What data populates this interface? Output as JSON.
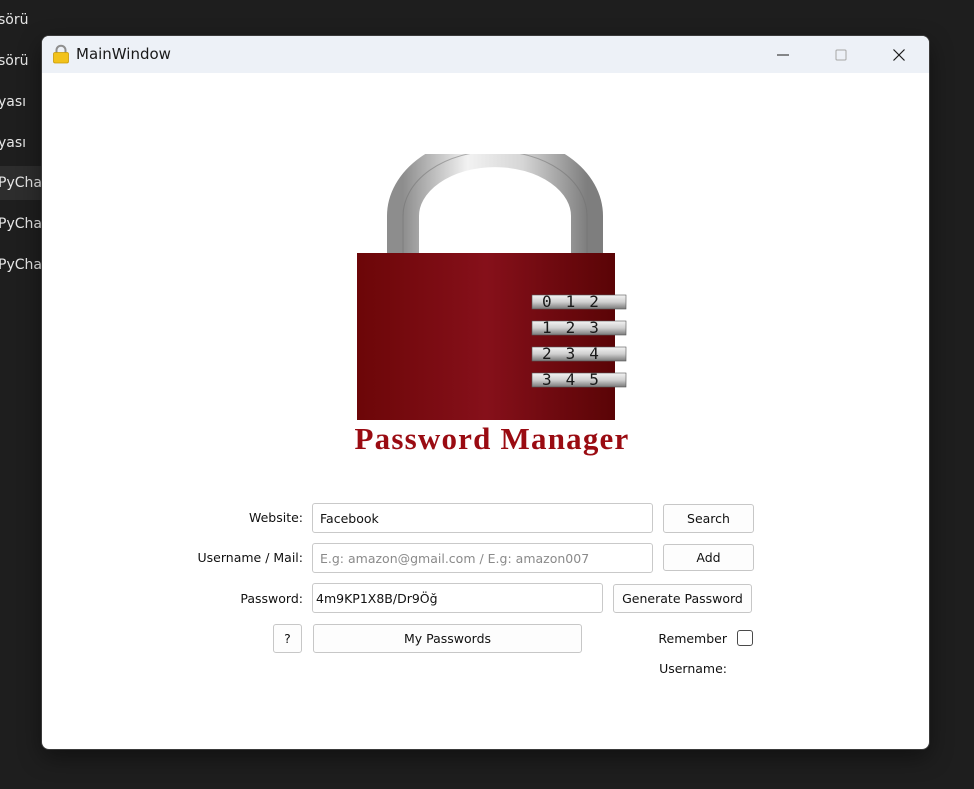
{
  "background_list": {
    "items": [
      {
        "label": "sörü"
      },
      {
        "label": "sörü"
      },
      {
        "label": "yası"
      },
      {
        "label": "yası"
      },
      {
        "label": "PyChar"
      },
      {
        "label": "PyChar"
      },
      {
        "label": "PyChar"
      }
    ]
  },
  "window": {
    "title": "MainWindow",
    "icon": "lock-icon",
    "controls": [
      "minimize-icon",
      "maximize-icon",
      "close-icon"
    ]
  },
  "logo": {
    "text": "Password Manager",
    "dial_rows": [
      "012",
      "123",
      "234",
      "345"
    ],
    "colors": {
      "body": "#7d0a0c",
      "text": "#9a0b12",
      "shackle": "#b9b9b9"
    }
  },
  "form": {
    "website_label": "Website:",
    "website_value": "Facebook",
    "search_label": "Search",
    "username_label": "Username / Mail:",
    "username_placeholder": "E.g: amazon@gmail.com / E.g: amazon007",
    "add_label": "Add",
    "password_label": "Password:",
    "password_value": "4m9KP1X8B/Dr9Öğ",
    "generate_label": "Generate Password",
    "help_label": "?",
    "my_passwords_label": "My Passwords",
    "remember_label": "Remember Username:",
    "remember_checked": false
  }
}
